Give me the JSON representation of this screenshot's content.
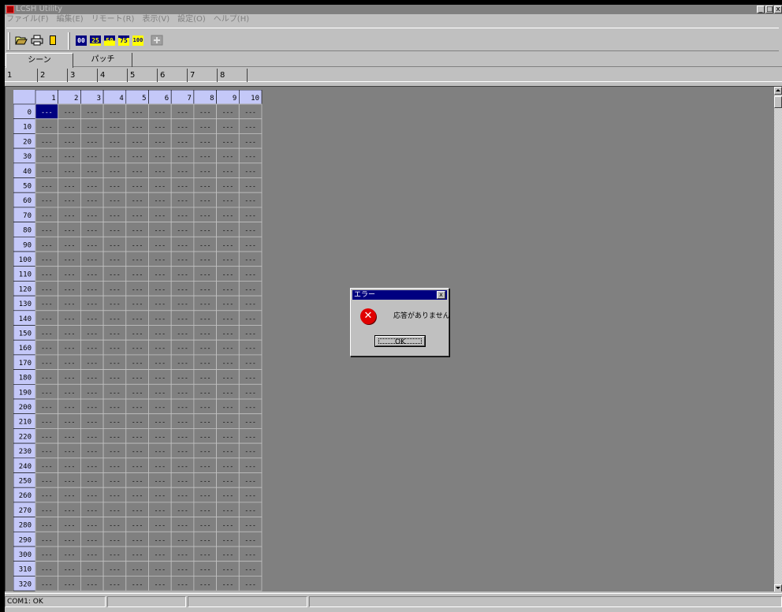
{
  "window": {
    "title": "LCSH Utility",
    "controls": [
      "_",
      "□",
      "x"
    ]
  },
  "menu": [
    "ファイル(F)",
    "編集(E)",
    "リモート(R)",
    "表示(V)",
    "設定(O)",
    "ヘルプ(H)"
  ],
  "toolbar": {
    "buttons": [
      {
        "name": "open-folder-icon"
      },
      {
        "name": "print-icon"
      },
      {
        "name": "exit-door-icon"
      }
    ],
    "level_buttons": [
      "00",
      "25",
      "50",
      "75",
      "100"
    ],
    "last_button": "transfer-icon"
  },
  "mode_tabs": [
    {
      "label": "シーン",
      "active": true
    },
    {
      "label": "パッチ",
      "active": false
    }
  ],
  "page_tabs": [
    "1",
    "2",
    "3",
    "4",
    "5",
    "6",
    "7",
    "8"
  ],
  "grid": {
    "columns": [
      "1",
      "2",
      "3",
      "4",
      "5",
      "6",
      "7",
      "8",
      "9",
      "10"
    ],
    "rows": [
      "0",
      "10",
      "20",
      "30",
      "40",
      "50",
      "60",
      "70",
      "80",
      "90",
      "100",
      "110",
      "120",
      "130",
      "140",
      "150",
      "160",
      "170",
      "180",
      "190",
      "200",
      "210",
      "220",
      "230",
      "240",
      "250",
      "260",
      "270",
      "280",
      "290",
      "300",
      "310",
      "320"
    ],
    "cell_value": "---",
    "selected_cell": {
      "row": 0,
      "col": 0
    }
  },
  "dialog": {
    "title": "エラー",
    "close": "x",
    "message": "応答がありません",
    "ok_label": "OK",
    "icon": "error-icon"
  },
  "statusbar": [
    "COM1: OK",
    "",
    "",
    "",
    ""
  ],
  "colors": {
    "titlebar_inactive": "#808080",
    "dialog_title": "#000080",
    "grid_header": "#c4c8f8",
    "grid_cell": "#808080",
    "selected_cell": "#000080",
    "error_icon": "#e00000"
  }
}
